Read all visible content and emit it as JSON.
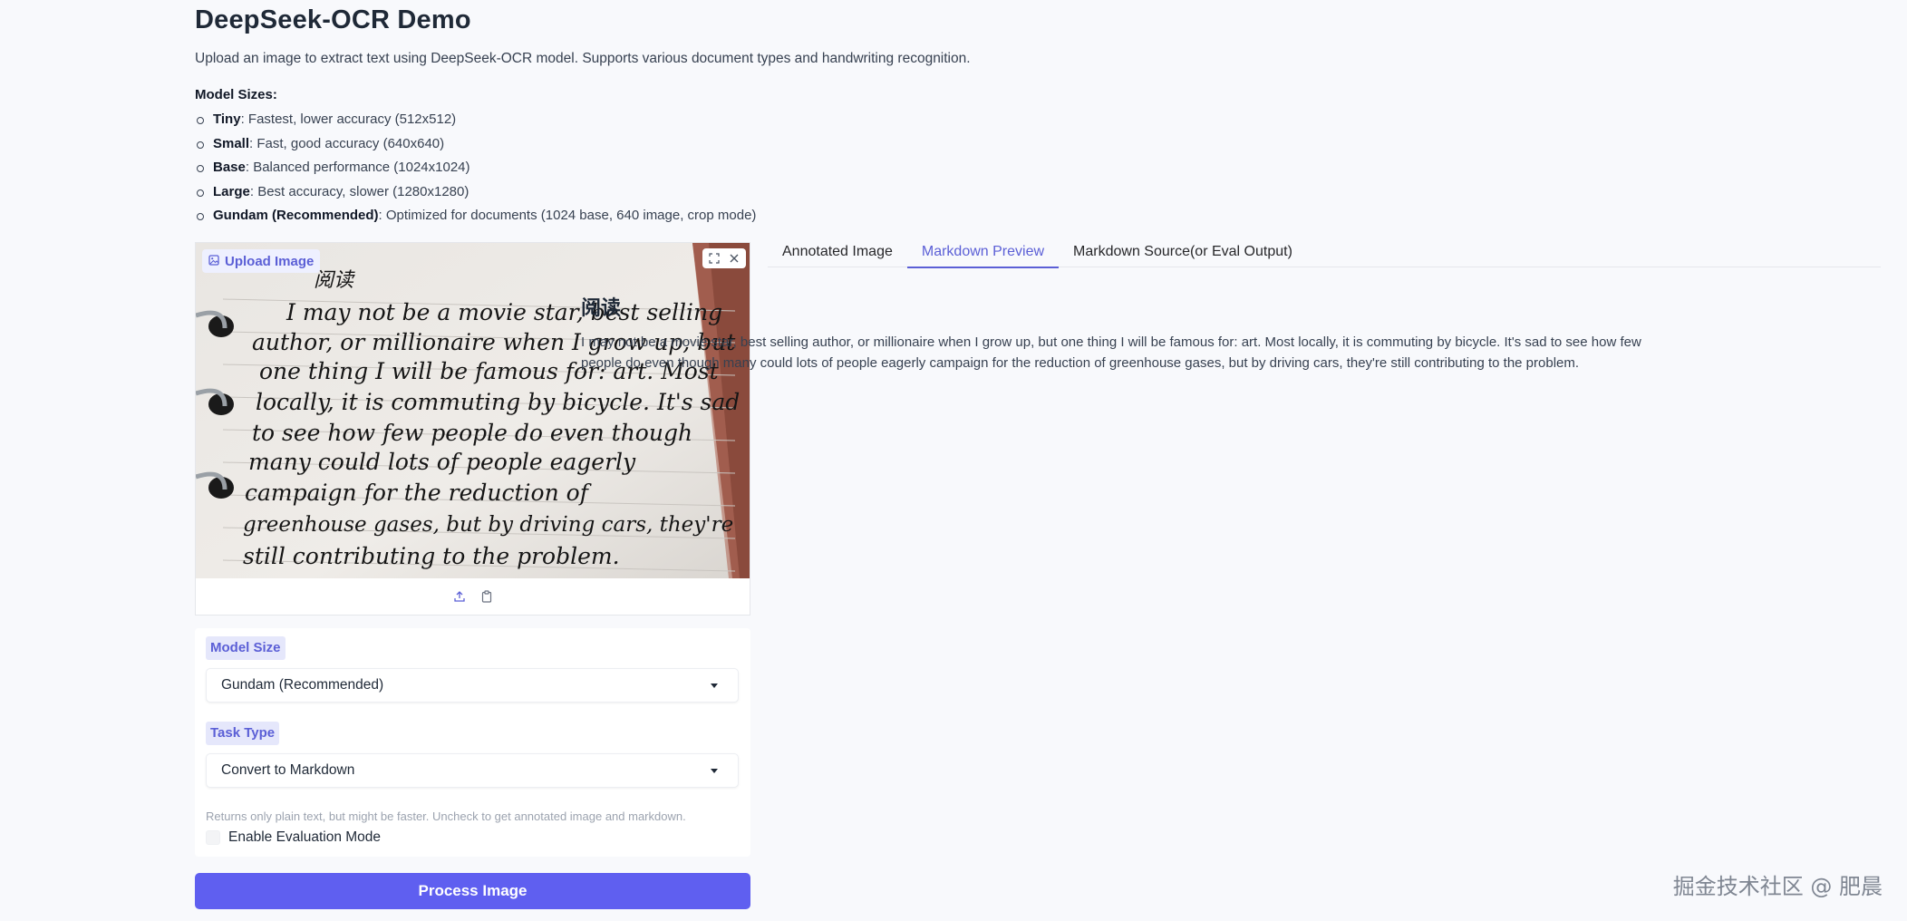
{
  "header": {
    "title": "DeepSeek-OCR Demo",
    "description": "Upload an image to extract text using DeepSeek-OCR model. Supports various document types and handwriting recognition.",
    "sizes_heading": "Model Sizes:"
  },
  "model_sizes": [
    {
      "name": "Tiny",
      "detail": ": Fastest, lower accuracy (512x512)"
    },
    {
      "name": "Small",
      "detail": ": Fast, good accuracy (640x640)"
    },
    {
      "name": "Base",
      "detail": ": Balanced performance (1024x1024)"
    },
    {
      "name": "Large",
      "detail": ": Best accuracy, slower (1280x1280)"
    },
    {
      "name": "Gundam (Recommended)",
      "detail": ": Optimized for documents (1024 base, 640 image, crop mode)"
    }
  ],
  "upload": {
    "label": "Upload Image",
    "handwriting": [
      "阅读",
      "I may not be a movie star, best selling",
      "author, or millionaire when I grow up, but",
      "one thing I will be famous for: art. Most",
      "locally, it is commuting by bicycle. It's sad",
      "to see how few people do even though",
      "many could lots of people eagerly",
      "campaign for the reduction of",
      "greenhouse gases, but by driving cars, they're",
      "still contributing to the problem."
    ]
  },
  "settings": {
    "model_size_label": "Model Size",
    "model_size_value": "Gundam (Recommended)",
    "task_type_label": "Task Type",
    "task_type_value": "Convert to Markdown",
    "eval_info": "Returns only plain text, but might be faster. Uncheck to get annotated image and markdown.",
    "eval_label": "Enable Evaluation Mode"
  },
  "process_button": "Process Image",
  "tabs": [
    "Annotated Image",
    "Markdown Preview",
    "Markdown Source(or Eval Output)"
  ],
  "active_tab": "Markdown Preview",
  "output": {
    "title": "阅读",
    "body": "I may not be a movie star, best selling author, or millionaire when I grow up, but one thing I will be famous for: art. Most locally, it is commuting by bicycle. It's sad to see how few people do even though many could lots of people eagerly campaign for the reduction of greenhouse gases, but by driving cars, they're still contributing to the problem."
  },
  "watermark": "掘金技术社区 @ 肥晨",
  "colors": {
    "accent": "#5b5fd6",
    "button": "#5f5ff0",
    "label_bg": "#e5e7fb"
  }
}
